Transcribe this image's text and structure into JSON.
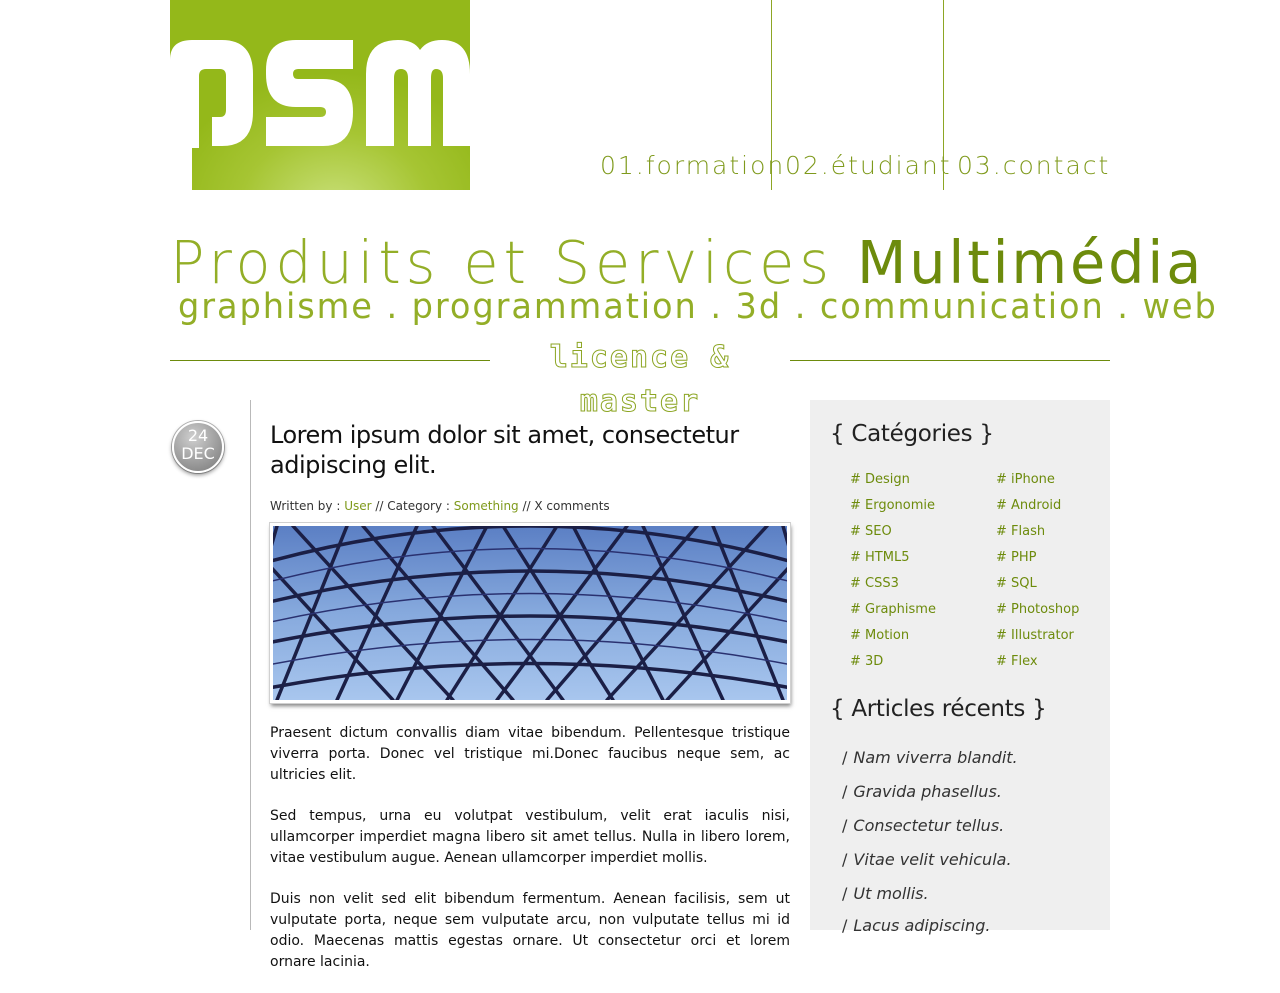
{
  "logo": {
    "text": "psm",
    "colors": {
      "light": "#c9e07a",
      "mid": "#a6c533",
      "dark": "#94b81a"
    }
  },
  "nav": {
    "items": [
      {
        "label": "01.formation"
      },
      {
        "label": "02.étudiant"
      },
      {
        "label": "03.contact"
      }
    ]
  },
  "hero": {
    "title_light": "Produits et Services ",
    "title_strong": "Multimédia",
    "subtitle": "graphisme . programmation . 3d . communication . web",
    "badge": "licence & master"
  },
  "post": {
    "date_day": "24",
    "date_month": "DEC",
    "title": "Lorem ipsum dolor sit amet, consectetur adipiscing elit.",
    "meta": {
      "written_by_label": "Written by : ",
      "author": "User",
      "category_label": " // Category : ",
      "category": "Something",
      "comments": " // X comments"
    },
    "paragraphs": [
      "Praesent dictum convallis diam vitae bibendum. Pellentesque tristique viverra porta. Donec vel tristique mi.Donec faucibus neque sem, ac ultricies elit.",
      "Sed tempus, urna eu volutpat vestibulum, velit erat iaculis nisi, ullamcorper imperdiet magna libero sit amet tellus. Nulla in libero lorem, vitae vestibulum augue. Aenean ullamcorper imperdiet mollis.",
      "Duis non velit sed elit bibendum fermentum. Aenean facilisis, sem ut vulputate porta, neque sem vulputate arcu, non vulputate tellus mi id odio. Maecenas mattis egestas ornare. Ut consectetur orci et lorem ornare lacinia."
    ]
  },
  "sidebar": {
    "categories_heading": "{ Catégories }",
    "categories_left": [
      "# Design",
      "# Ergonomie",
      "# SEO",
      "# HTML5",
      "# CSS3",
      "# Graphisme",
      "# Motion",
      "# 3D"
    ],
    "categories_right": [
      "# iPhone",
      "# Android",
      "# Flash",
      "# PHP",
      "# SQL",
      "# Photoshop",
      "# Illustrator",
      "# Flex"
    ],
    "recent_heading": "{ Articles récents }",
    "recent_slash": "/",
    "recent": [
      "Nam viverra blandit.",
      "Gravida phasellus.",
      "Consectetur tellus.",
      "Vitae velit vehicula.",
      "Ut mollis.",
      "Lacus adipiscing."
    ]
  },
  "colors": {
    "accent": "#93ae27",
    "accent_dark": "#6d8b0c",
    "sidebar_bg": "#efefef"
  }
}
